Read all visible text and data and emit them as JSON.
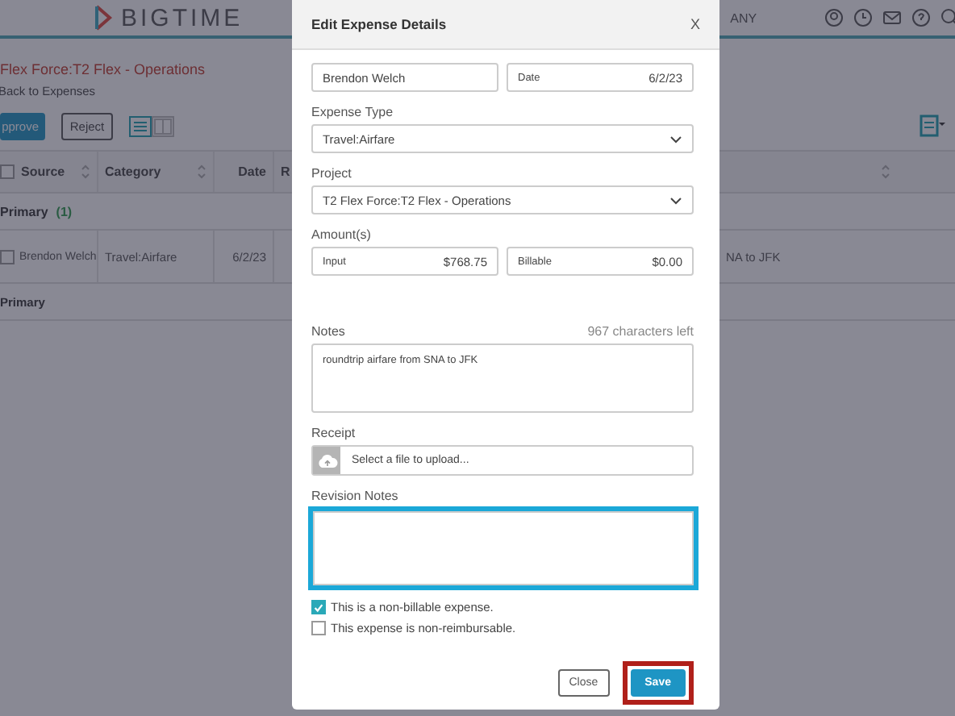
{
  "header": {
    "logo": "BIGTIME",
    "company": "ANY"
  },
  "page": {
    "title": "Flex Force:T2 Flex - Operations",
    "back_link": "Back to Expenses",
    "buttons": [
      {
        "label": "pprove",
        "kind": "primary"
      },
      {
        "label": "Reject",
        "kind": "secondary"
      }
    ],
    "view_toggle": [
      {
        "selected": true
      },
      {
        "selected": false
      }
    ]
  },
  "table": {
    "select_all_checked": false,
    "columns": [
      "Source",
      "Category",
      "Date",
      "R"
    ],
    "rows": [
      {
        "kind": "group",
        "label": "Primary",
        "count": "(1)"
      },
      {
        "kind": "item",
        "source": "Brendon Welch",
        "category": "Travel:Airfare",
        "date": "6/2/23",
        "notes": "NA to JFK",
        "checked": false
      },
      {
        "kind": "group",
        "label": "Primary"
      }
    ]
  },
  "modal": {
    "title": "Edit Expense Details",
    "close": "X",
    "name": "Brendon Welch",
    "date_label": "Date",
    "date": "6/2/23",
    "expense_type_label": "Expense Type",
    "expense_type": "Travel:Airfare",
    "project_label": "Project",
    "project": "T2 Flex Force:T2 Flex - Operations",
    "amounts_label": "Amount(s)",
    "input_label": "Input",
    "input": "$768.75",
    "billable_label": "Billable",
    "billable": "$0.00",
    "notes_label": "Notes",
    "notes_counter": "967 characters left",
    "notes": "roundtrip airfare from SNA to JFK",
    "receipt_label": "Receipt",
    "receipt_placeholder": "Select a file to upload...",
    "revision_label": "Revision Notes",
    "revision_highlighted": true,
    "checkboxes": [
      {
        "label": "This is a non-billable expense.",
        "checked": true
      },
      {
        "label": "This expense is non-reimbursable.",
        "checked": false
      }
    ],
    "buttons": [
      {
        "label": "Close",
        "kind": "secondary",
        "highlighted": false
      },
      {
        "label": "Save",
        "kind": "primary",
        "highlighted": true
      }
    ]
  }
}
